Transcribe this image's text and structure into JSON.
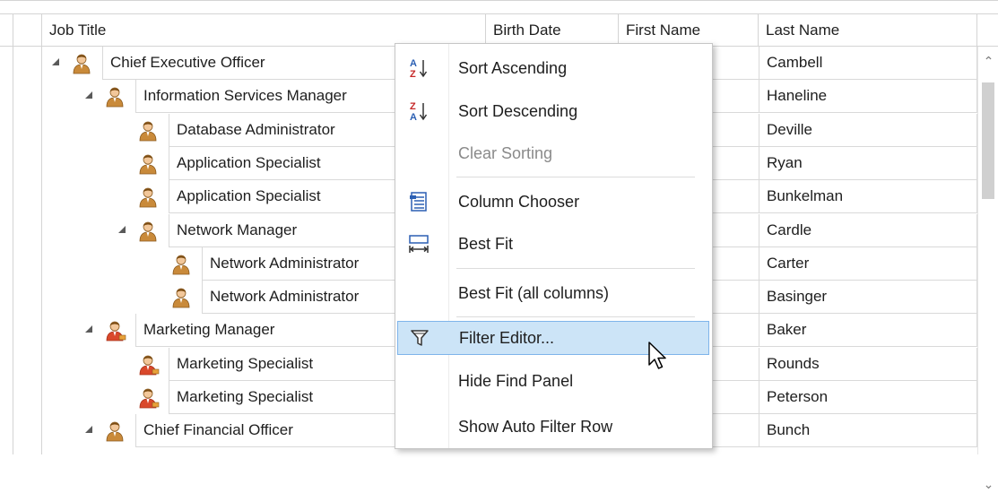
{
  "columns": {
    "job_title": "Job Title",
    "birth_date": "Birth Date",
    "first_name": "First Name",
    "last_name": "Last Name"
  },
  "rows": [
    {
      "job": "Chief Executive Officer",
      "last": "Cambell"
    },
    {
      "job": "Information Services Manager",
      "last": "Haneline"
    },
    {
      "job": "Database Administrator",
      "last": "Deville"
    },
    {
      "job": "Application Specialist",
      "last": "Ryan"
    },
    {
      "job": "Application Specialist",
      "last": "Bunkelman"
    },
    {
      "job": "Network Manager",
      "last": "Cardle"
    },
    {
      "job": "Network Administrator",
      "last": "Carter"
    },
    {
      "job": "Network Administrator",
      "last": "Basinger"
    },
    {
      "job": "Marketing Manager",
      "last": "Baker"
    },
    {
      "job": "Marketing Specialist",
      "last": "Rounds"
    },
    {
      "job": "Marketing Specialist",
      "last": "Peterson"
    },
    {
      "job": "Chief Financial Officer",
      "last": "Bunch"
    }
  ],
  "menu": {
    "sort_ascending": "Sort Ascending",
    "sort_descending": "Sort Descending",
    "clear_sorting": "Clear Sorting",
    "column_chooser": "Column Chooser",
    "best_fit": "Best Fit",
    "best_fit_all": "Best Fit (all columns)",
    "filter_editor": "Filter Editor...",
    "hide_find_panel": "Hide Find Panel",
    "show_auto_filter_row": "Show Auto Filter Row"
  },
  "icons": {
    "sort_ascending_top": "A",
    "sort_ascending_bottom": "Z",
    "sort_descending_top": "Z",
    "sort_descending_bottom": "A"
  },
  "colors": {
    "hover_bg": "#cce4f7",
    "hover_border": "#7eb4ea",
    "person_default": "#c98a3a",
    "person_marketing": "#d9482b"
  }
}
